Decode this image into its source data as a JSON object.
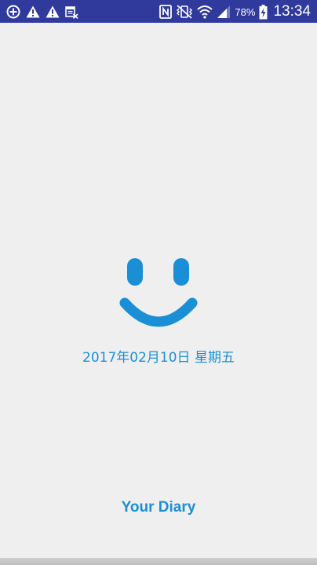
{
  "status_bar": {
    "left_icons": [
      "add-circle-icon",
      "warning-icon",
      "warning-icon",
      "calendar-x-icon"
    ],
    "right_icons": [
      "nfc-icon",
      "vibrate-mute-icon",
      "wifi-icon",
      "signal-icon",
      "battery-charging-icon"
    ],
    "battery_percent": "78%",
    "time": "13:34"
  },
  "splash": {
    "logo_icon": "smiley-face-icon",
    "date": "2017年02月10日 星期五",
    "app_name": "Your Diary"
  },
  "colors": {
    "status_bar": "#2f3a9c",
    "background": "#efefef",
    "accent": "#1b8fd6"
  }
}
